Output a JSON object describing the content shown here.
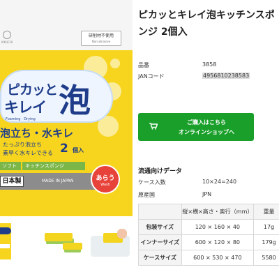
{
  "product": {
    "title_line1": "ピカッとキレイ泡キッチンスポ",
    "title_line2": "ンジ 2個入"
  },
  "package": {
    "brand": "KIKUCHI",
    "no_abrasive_jp": "研削材不使用",
    "no_abrasive_en": "Non-abrasive",
    "title_small1": "ピカッと",
    "title_small2": "キレイ",
    "title_big": "泡",
    "subtitle_en": "Foaming · Drying",
    "slogan": "泡立ち・水キレ",
    "point1": "たっぷり泡立ち",
    "point2": "素早く水キレできる",
    "count": "2",
    "count_unit": "個入",
    "label_soft": "ソフト",
    "label_kind": "キッチンスポンジ",
    "made_jp": "日本製",
    "made_in": "MADE IN JAPAN",
    "wash_jp": "あらう",
    "wash_en": "Wash"
  },
  "specs": {
    "product_no_label": "品番",
    "product_no_value": "3858",
    "jan_label": "JANコード",
    "jan_value": "4956810238583"
  },
  "buy_button": {
    "line1": "ご購入はこちら",
    "line2": "オンラインショップへ",
    "icon": "cart-icon"
  },
  "distribution": {
    "heading": "流通向けデータ",
    "case_qty_label": "ケース入数",
    "case_qty_value": "10×24=240",
    "origin_label": "原産国",
    "origin_value": "JPN"
  },
  "table": {
    "headers": [
      "",
      "縦×横×高さ・奥行（mm）",
      "重量"
    ],
    "rows": [
      {
        "label": "包装サイズ",
        "dims": "120 × 160 × 40",
        "weight": "17g"
      },
      {
        "label": "インナーサイズ",
        "dims": "600 × 120 × 80",
        "weight": "179g"
      },
      {
        "label": "ケースサイズ",
        "dims": "600 × 530 × 470",
        "weight": "5580"
      }
    ]
  },
  "colors": {
    "buy_green": "#1aa02a",
    "package_yellow": "#f7d51e",
    "package_navy": "#1e3c8a",
    "wash_red": "#e8433a"
  }
}
